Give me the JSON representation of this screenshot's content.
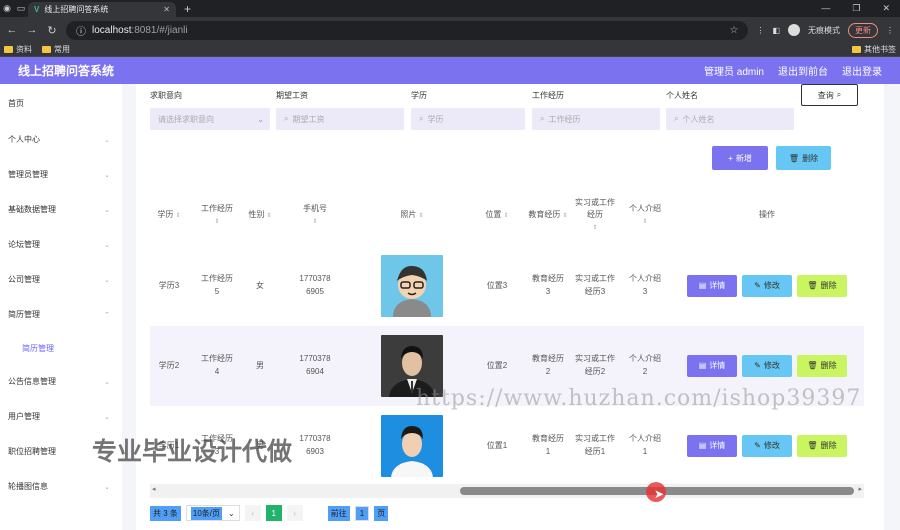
{
  "browser": {
    "tab_title": "线上招聘问答系统",
    "url_host": "localhost",
    "url_path": ":8081/#/jianli",
    "incognito_label": "无痕模式",
    "update_label": "更新",
    "bookmarks": [
      "资料",
      "常用"
    ],
    "other_bookmarks": "其他书签"
  },
  "header": {
    "title": "线上招聘问答系统",
    "admin": "管理员 admin",
    "back_front": "退出到前台",
    "logout": "退出登录",
    "color": "#7b72f0"
  },
  "sidebar": {
    "items": [
      "首页",
      "个人中心",
      "管理员管理",
      "基础数据管理",
      "论坛管理",
      "公司管理",
      "简历管理",
      "公告信息管理",
      "用户管理",
      "职位招聘管理",
      "轮播图信息"
    ],
    "active_sub": "简历管理"
  },
  "search": {
    "fields": [
      {
        "label": "求职意向",
        "placeholder": "请选择求职意向"
      },
      {
        "label": "期望工资",
        "placeholder": "期望工资"
      },
      {
        "label": "学历",
        "placeholder": "学历"
      },
      {
        "label": "工作经历",
        "placeholder": "工作经历"
      },
      {
        "label": "个人姓名",
        "placeholder": "个人姓名"
      }
    ],
    "query_label": "查询"
  },
  "actions": {
    "add": "新增",
    "delete": "删除"
  },
  "table": {
    "headers": [
      "学历",
      "工作经历",
      "性别",
      "手机号",
      "照片",
      "位置",
      "教育经历",
      "实习或工作经历",
      "个人介绍",
      "操作"
    ],
    "rows": [
      {
        "edu": "学历3",
        "work": "工作经历5",
        "gender": "女",
        "phone": "17703786905",
        "photo": "cartoon-avatar",
        "pos": "位置3",
        "eduexp": "教育经历3",
        "intern": "实习或工作经历3",
        "intro": "个人介绍3"
      },
      {
        "edu": "学历2",
        "work": "工作经历4",
        "gender": "男",
        "phone": "17703786904",
        "photo": "man-suit-dark",
        "pos": "位置2",
        "eduexp": "教育经历2",
        "intern": "实习或工作经历2",
        "intro": "个人介绍2"
      },
      {
        "edu": "学历1",
        "work": "工作经历3",
        "gender": "男",
        "phone": "17703786903",
        "photo": "man-blue-bg",
        "pos": "位置1",
        "eduexp": "教育经历1",
        "intern": "实习或工作经历1",
        "intro": "个人介绍1"
      }
    ],
    "op_labels": {
      "detail": "详情",
      "edit": "修改",
      "delete": "删除"
    }
  },
  "pagination": {
    "total": "共 3 条",
    "page_size": "10条/页",
    "current": "1",
    "goto_label": "前往",
    "goto_value": "1",
    "page_suffix": "页"
  },
  "watermark": {
    "url": "https://www.huzhan.com/ishop39397",
    "text": "专业毕业设计代做"
  }
}
